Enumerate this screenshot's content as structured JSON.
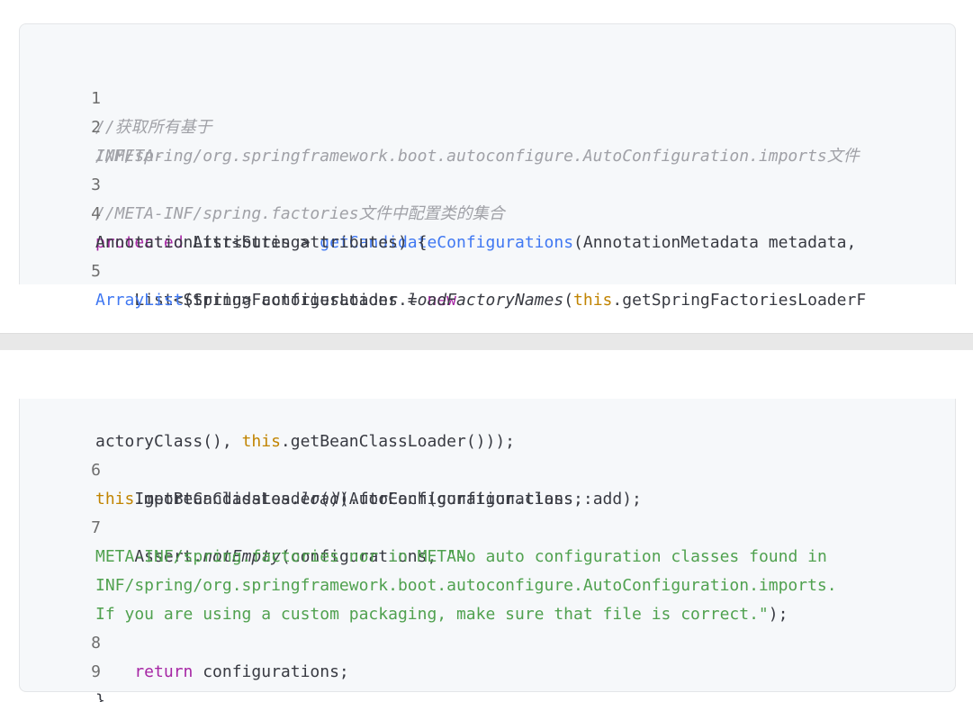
{
  "lines": {
    "l1": {
      "num": "1",
      "comment": "//获取所有基于"
    },
    "l2": {
      "num": "2",
      "comment_a": "//META-",
      "comment_b": "INF/spring/org.springframework.boot.autoconfigure.AutoConfiguration.imports文件"
    },
    "l3": {
      "num": "3",
      "comment": "//META-INF/spring.factories文件中配置类的集合"
    },
    "l4": {
      "num": "4",
      "kw": "protected",
      "t1": " List<String> ",
      "fn": "getCandidateConfigurations",
      "t2": "(AnnotationMetadata metadata,",
      "cont": "AnnotationAttributes attributes) {"
    },
    "l5": {
      "num": "5",
      "t1": "    List<String> configurations = ",
      "kw": "new",
      "fn": "ArrayList",
      "t2": "(SpringFactoriesLoader.",
      "it": "loadFactoryNames",
      "t3": "(",
      "th": "this",
      "t4": ".getSpringFactoriesLoaderF",
      "cont_a": "actoryClass(), ",
      "cont_th": "this",
      "cont_b": ".getBeanClassLoader()));"
    },
    "l6": {
      "num": "6",
      "t1": "    ImportCandidates.",
      "it": "load",
      "t2": "(AutoConfiguration.class,",
      "cont_th": "this",
      "cont_b": ".getBeanClassLoader()).forEach(configurations::add);"
    },
    "l7": {
      "num": "7",
      "t1": "    Assert.",
      "it": "notEmpty",
      "t2": "(configurations, ",
      "st1": "\"No auto configuration classes found in",
      "st2": "META-INF/spring.factories nor in META-",
      "st3": "INF/spring/org.springframework.boot.autoconfigure.AutoConfiguration.imports.",
      "st4": "If you are using a custom packaging, make sure that file is correct.\"",
      "t3": ");"
    },
    "l8": {
      "num": "8",
      "kw": "    return",
      "t1": " configurations;"
    },
    "l9": {
      "num": "9",
      "t1": "}"
    }
  },
  "colors": {
    "keyword": "#a626a4",
    "function": "#4078f2",
    "this": "#c18401",
    "string": "#50a14f",
    "comment": "#a0a1a7",
    "background": "#f6f8fa"
  }
}
